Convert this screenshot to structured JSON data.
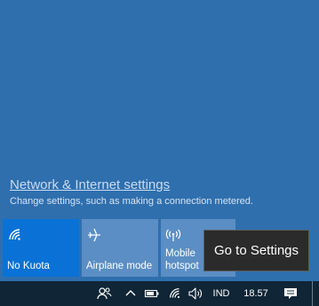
{
  "network_panel": {
    "settings_link": "Network & Internet settings",
    "settings_desc": "Change settings, such as making a connection metered."
  },
  "quick_actions": [
    {
      "label": "No Kuota",
      "icon": "wifi-icon",
      "state": "on"
    },
    {
      "label": "Airplane mode",
      "icon": "airplane-icon",
      "state": "off"
    },
    {
      "label": "Mobile hotspot",
      "label_line1": "Mobile",
      "label_line2": "hotspot",
      "icon": "hotspot-icon",
      "state": "off"
    }
  ],
  "tooltip": {
    "text": "Go to Settings"
  },
  "taskbar": {
    "language": "IND",
    "time": "18.57",
    "tray_icons": [
      "people-icon",
      "chevron-up-icon",
      "battery-icon",
      "wifi-icon",
      "volume-icon",
      "notification-icon"
    ]
  },
  "colors": {
    "panel_bg": "#2f6fae",
    "tile_active": "#0a72d6",
    "tile_inactive": "#5b8ec4",
    "taskbar_bg": "#102536",
    "tooltip_bg": "#2b2b2b"
  }
}
